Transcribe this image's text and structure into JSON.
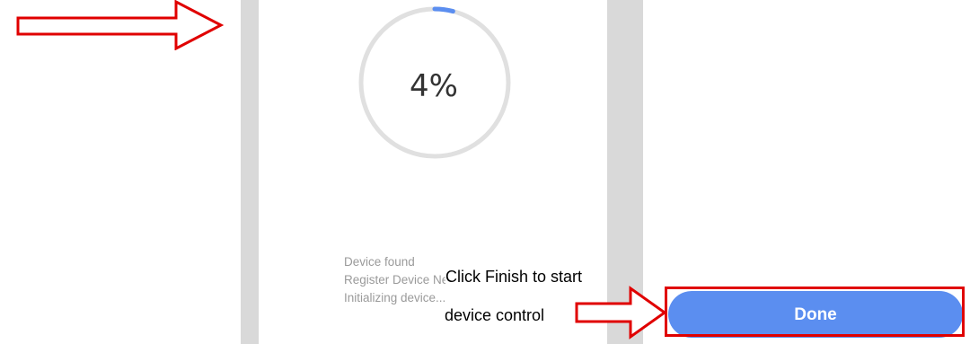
{
  "progress": {
    "percent_label": "4%",
    "value": 0.04
  },
  "status_lines": [
    "Device found",
    "Register Device Network",
    "Initializing device..."
  ],
  "annotation": {
    "caption_line1": "Click  Finish  to  start",
    "caption_line2": "device control"
  },
  "done_button": {
    "label": "Done"
  },
  "colors": {
    "accent": "#5b8ef0",
    "annotation_red": "#e00000",
    "ring_track": "#e0e0e0"
  }
}
